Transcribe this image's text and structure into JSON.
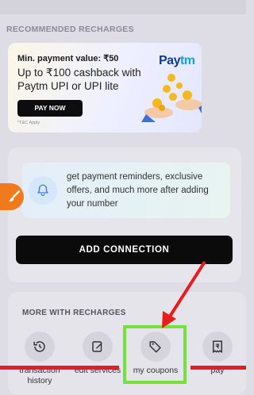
{
  "section_title": "RECOMMENDED RECHARGES",
  "banner": {
    "min_payment": "Min. payment value: ₹50",
    "headline": "Up to ₹100 cashback with Paytm UPI or UPI lite",
    "button_label": "PAY NOW",
    "tc": "*T&C Apply",
    "brand_a": "Pay",
    "brand_b": "tm"
  },
  "reminder": {
    "text": "get payment reminders, exclusive offers, and much more after adding your number"
  },
  "add_connection_label": "ADD CONNECTION",
  "more": {
    "title": "MORE WITH RECHARGES",
    "shortcuts": [
      {
        "label": "transaction history",
        "icon": "history-icon"
      },
      {
        "label": "edit services",
        "icon": "edit-icon"
      },
      {
        "label": "my coupons",
        "icon": "tag-icon"
      },
      {
        "label": "pay",
        "icon": "rupee-receipt-icon"
      }
    ]
  },
  "annotation_colors": {
    "arrow": "#ea1b1b",
    "highlight": "#78e03a"
  }
}
